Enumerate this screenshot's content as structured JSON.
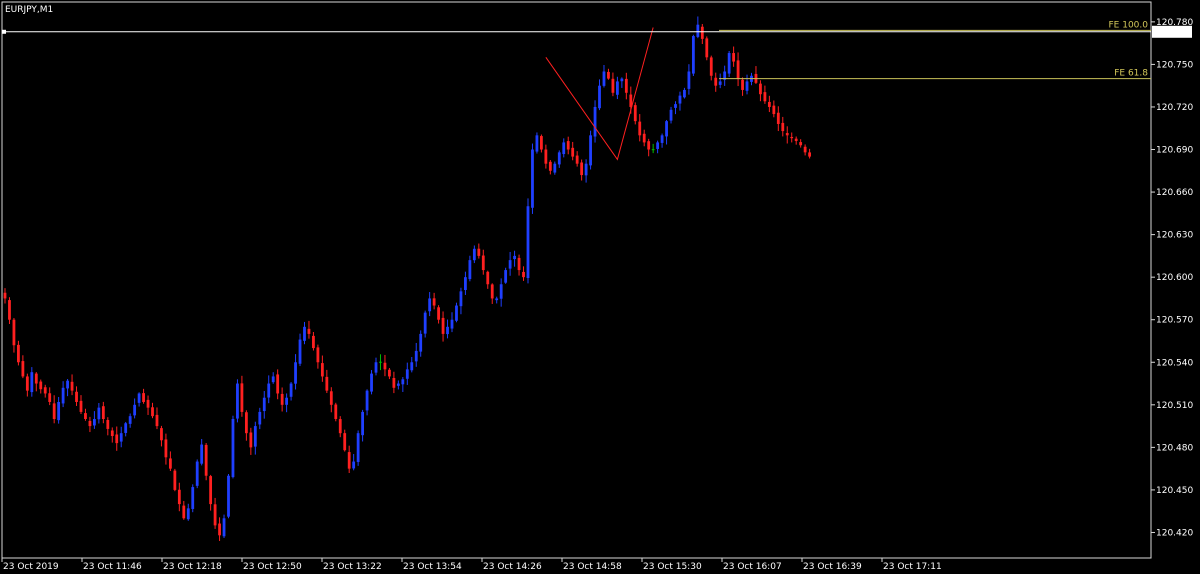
{
  "window": {
    "symbol_label": "EURJPY,M1"
  },
  "colors": {
    "background": "#000000",
    "frame": "#d8d8d8",
    "bull": "#1f3fff",
    "bear": "#ff2020",
    "doji": "#00c000",
    "fibo": "#c9c25a",
    "bid_line": "#ffffff",
    "bid_box_bg": "#ffffff",
    "bid_box_text": "#000000"
  },
  "chart_data": {
    "type": "candlestick",
    "title": "EURJPY,M1",
    "xlabel": "",
    "ylabel": "",
    "ylim": [
      120.402,
      120.794
    ],
    "grid": false,
    "y_ticks": [
      "120.780",
      "120.750",
      "120.720",
      "120.690",
      "120.660",
      "120.630",
      "120.600",
      "120.570",
      "120.540",
      "120.510",
      "120.480",
      "120.450",
      "120.420"
    ],
    "x_ticks": [
      "23 Oct 2019",
      "23 Oct 11:46",
      "23 Oct 12:18",
      "23 Oct 12:50",
      "23 Oct 13:22",
      "23 Oct 13:54",
      "23 Oct 14:26",
      "23 Oct 14:58",
      "23 Oct 15:30",
      "23 Oct 16:07",
      "23 Oct 16:39",
      "23 Oct 17:11"
    ],
    "close_path": [
      120.585,
      120.57,
      120.552,
      120.54,
      120.53,
      120.52,
      120.533,
      120.525,
      120.521,
      120.518,
      120.512,
      120.5,
      120.512,
      120.522,
      120.527,
      120.52,
      120.512,
      120.505,
      120.5,
      120.495,
      120.5,
      120.508,
      120.5,
      120.493,
      120.488,
      120.483,
      120.49,
      120.497,
      120.502,
      120.51,
      120.518,
      120.512,
      120.508,
      120.502,
      120.495,
      120.485,
      120.473,
      120.465,
      120.45,
      120.44,
      120.43,
      120.437,
      120.452,
      120.47,
      120.482,
      120.46,
      120.44,
      120.425,
      120.418,
      120.43,
      120.46,
      120.5,
      120.525,
      120.505,
      120.49,
      120.48,
      120.495,
      120.505,
      120.515,
      120.525,
      120.53,
      120.518,
      120.51,
      120.515,
      120.525,
      120.54,
      120.556,
      120.565,
      120.56,
      120.55,
      120.54,
      120.53,
      120.52,
      120.51,
      120.5,
      120.49,
      120.478,
      120.465,
      120.47,
      120.49,
      120.505,
      120.52,
      120.532,
      120.54,
      120.54,
      120.535,
      120.53,
      120.522,
      120.525,
      120.528,
      120.535,
      120.54,
      120.548,
      120.56,
      120.575,
      120.585,
      120.58,
      120.57,
      120.56,
      120.565,
      120.57,
      120.58,
      120.59,
      120.6,
      120.612,
      120.62,
      120.615,
      120.605,
      120.595,
      120.585,
      120.585,
      120.595,
      120.605,
      120.612,
      120.615,
      120.605,
      120.6,
      120.65,
      120.69,
      120.7,
      120.69,
      120.68,
      120.675,
      120.68,
      120.688,
      120.695,
      120.69,
      120.685,
      120.68,
      120.672,
      120.68,
      120.7,
      120.72,
      120.735,
      120.745,
      120.74,
      120.73,
      120.738,
      120.74,
      120.73,
      120.72,
      120.71,
      120.7,
      120.695,
      120.69,
      120.69,
      120.695,
      120.7,
      120.71,
      120.718,
      120.722,
      120.728,
      120.732,
      120.745,
      120.77,
      120.778,
      120.768,
      120.755,
      120.742,
      120.735,
      120.738,
      120.745,
      120.758,
      120.752,
      120.74,
      120.732,
      120.738,
      120.742,
      120.737,
      120.729,
      120.724,
      120.72,
      120.715,
      120.708,
      120.703,
      120.7,
      120.698,
      120.696,
      120.693,
      120.688,
      120.685
    ]
  },
  "fibo": {
    "top_level_price": 120.796,
    "levels": [
      {
        "label": "FE 100.0",
        "price": 120.774
      },
      {
        "label": "FE 61.8",
        "price": 120.74
      }
    ],
    "zigzag": [
      {
        "bar": 121,
        "price": 120.755
      },
      {
        "bar": 137,
        "price": 120.683
      },
      {
        "bar": 145,
        "price": 120.776
      }
    ]
  },
  "bid": {
    "price": 120.773,
    "label": "120.773"
  }
}
